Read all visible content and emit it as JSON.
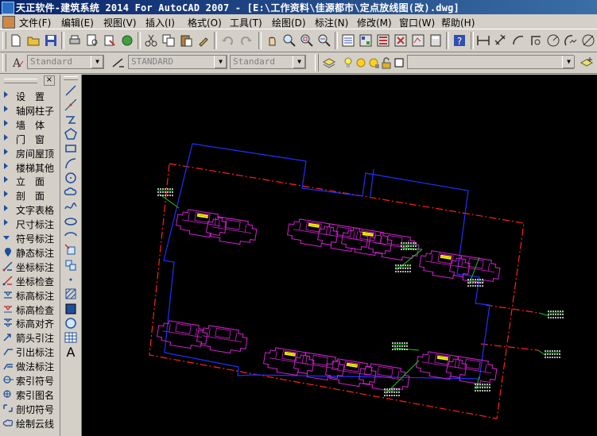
{
  "window": {
    "title": "天正软件-建筑系统 2014  For AutoCAD 2007 - [E:\\工作资料\\佳源都市\\定点放线图(改).dwg]"
  },
  "menu": {
    "items": [
      "文件(F)",
      "编辑(E)",
      "视图(V)",
      "插入(I)",
      "格式(O)",
      "工具(T)",
      "绘图(D)",
      "标注(N)",
      "修改(M)",
      "窗口(W)",
      "帮助(H)"
    ]
  },
  "styles_toolbar": {
    "text_style": "Standard",
    "dim_style": "STANDARD",
    "table_style": "Standard"
  },
  "palette": {
    "close_glyph": "×",
    "items": [
      {
        "label": "设　置",
        "kind": "folder"
      },
      {
        "label": "轴网柱子",
        "kind": "folder"
      },
      {
        "label": "墙　体",
        "kind": "folder"
      },
      {
        "label": "门　窗",
        "kind": "folder"
      },
      {
        "label": "房间屋顶",
        "kind": "folder"
      },
      {
        "label": "楼梯其他",
        "kind": "folder"
      },
      {
        "label": "立　面",
        "kind": "folder"
      },
      {
        "label": "剖　面",
        "kind": "folder"
      },
      {
        "label": "文字表格",
        "kind": "folder"
      },
      {
        "label": "尺寸标注",
        "kind": "folder"
      },
      {
        "label": "符号标注",
        "kind": "open"
      },
      {
        "label": "静态标注",
        "kind": "command",
        "icon": "pin-icon"
      },
      {
        "label": "坐标标注",
        "kind": "command",
        "icon": "coord-dim-icon"
      },
      {
        "label": "坐标检查",
        "kind": "command",
        "icon": "coord-check-icon"
      },
      {
        "label": "标高标注",
        "kind": "command",
        "icon": "elevation-icon"
      },
      {
        "label": "标高检查",
        "kind": "command",
        "icon": "elevation-check-icon"
      },
      {
        "label": "标高对齐",
        "kind": "command",
        "icon": "elevation-align-icon"
      },
      {
        "label": "箭头引注",
        "kind": "command",
        "icon": "arrow-note-icon"
      },
      {
        "label": "引出标注",
        "kind": "command",
        "icon": "leader-icon"
      },
      {
        "label": "做法标注",
        "kind": "command",
        "icon": "method-note-icon"
      },
      {
        "label": "索引符号",
        "kind": "command",
        "icon": "index-symbol-icon"
      },
      {
        "label": "索引图名",
        "kind": "command",
        "icon": "index-name-icon"
      },
      {
        "label": "剖切符号",
        "kind": "command",
        "icon": "section-symbol-icon"
      },
      {
        "label": "绘制云线",
        "kind": "command",
        "icon": "cloud-icon"
      }
    ]
  },
  "draw_tools": [
    "line-icon",
    "construction-line-icon",
    "polyline-icon",
    "polygon-icon",
    "rectangle-icon",
    "arc-icon",
    "circle-icon",
    "revcloud-icon",
    "spline-icon",
    "ellipse-icon",
    "ellipse-arc-icon",
    "insert-block-icon",
    "make-block-icon",
    "point-icon",
    "hatch-icon",
    "gradient-icon",
    "region-icon",
    "table-icon",
    "mtext-icon"
  ],
  "mtext_glyph": "A",
  "colors": {
    "boundary": "#ff2020",
    "building": "#d020d0",
    "fence": "#2030ff",
    "stair": "#ffff00",
    "leader": "#20c020",
    "label": "#f0f0f0"
  }
}
